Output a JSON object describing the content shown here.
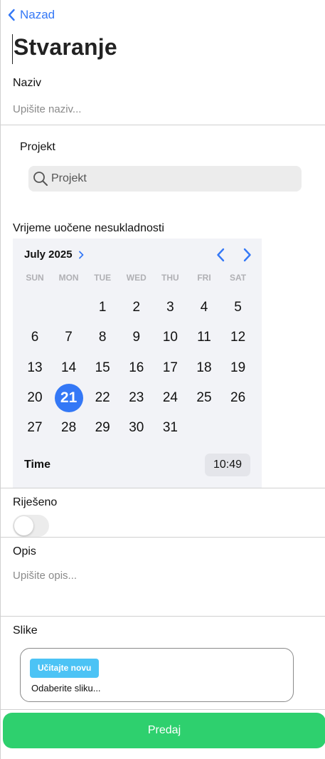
{
  "header": {
    "back_label": "Nazad",
    "title": "Stvaranje"
  },
  "form": {
    "name_label": "Naziv",
    "name_placeholder": "Upišite naziv...",
    "project_label": "Projekt",
    "project_search_placeholder": "Projekt",
    "datetime_label": "Vrijeme uočene nesukladnosti",
    "resolved_label": "Riješeno",
    "resolved_value": false,
    "description_label": "Opis",
    "description_placeholder": "Upišite opis...",
    "images_label": "Slike",
    "upload_button_label": "Učitajte novu",
    "upload_hint": "Odaberite sliku...",
    "submit_label": "Predaj"
  },
  "calendar": {
    "month_label": "July 2025",
    "weekdays": [
      "SUN",
      "MON",
      "TUE",
      "WED",
      "THU",
      "FRI",
      "SAT"
    ],
    "first_weekday_index": 2,
    "days_in_month": 31,
    "selected_day": 21,
    "time_label": "Time",
    "time_value": "10:49"
  },
  "colors": {
    "accent": "#3478f6",
    "submit": "#2ed06e",
    "upload_button": "#4cc3f5"
  },
  "icons": {
    "back": "chevron-left-icon",
    "search": "search-icon",
    "month_picker": "chevron-right-icon",
    "prev_month": "chevron-left-icon",
    "next_month": "chevron-right-icon"
  }
}
